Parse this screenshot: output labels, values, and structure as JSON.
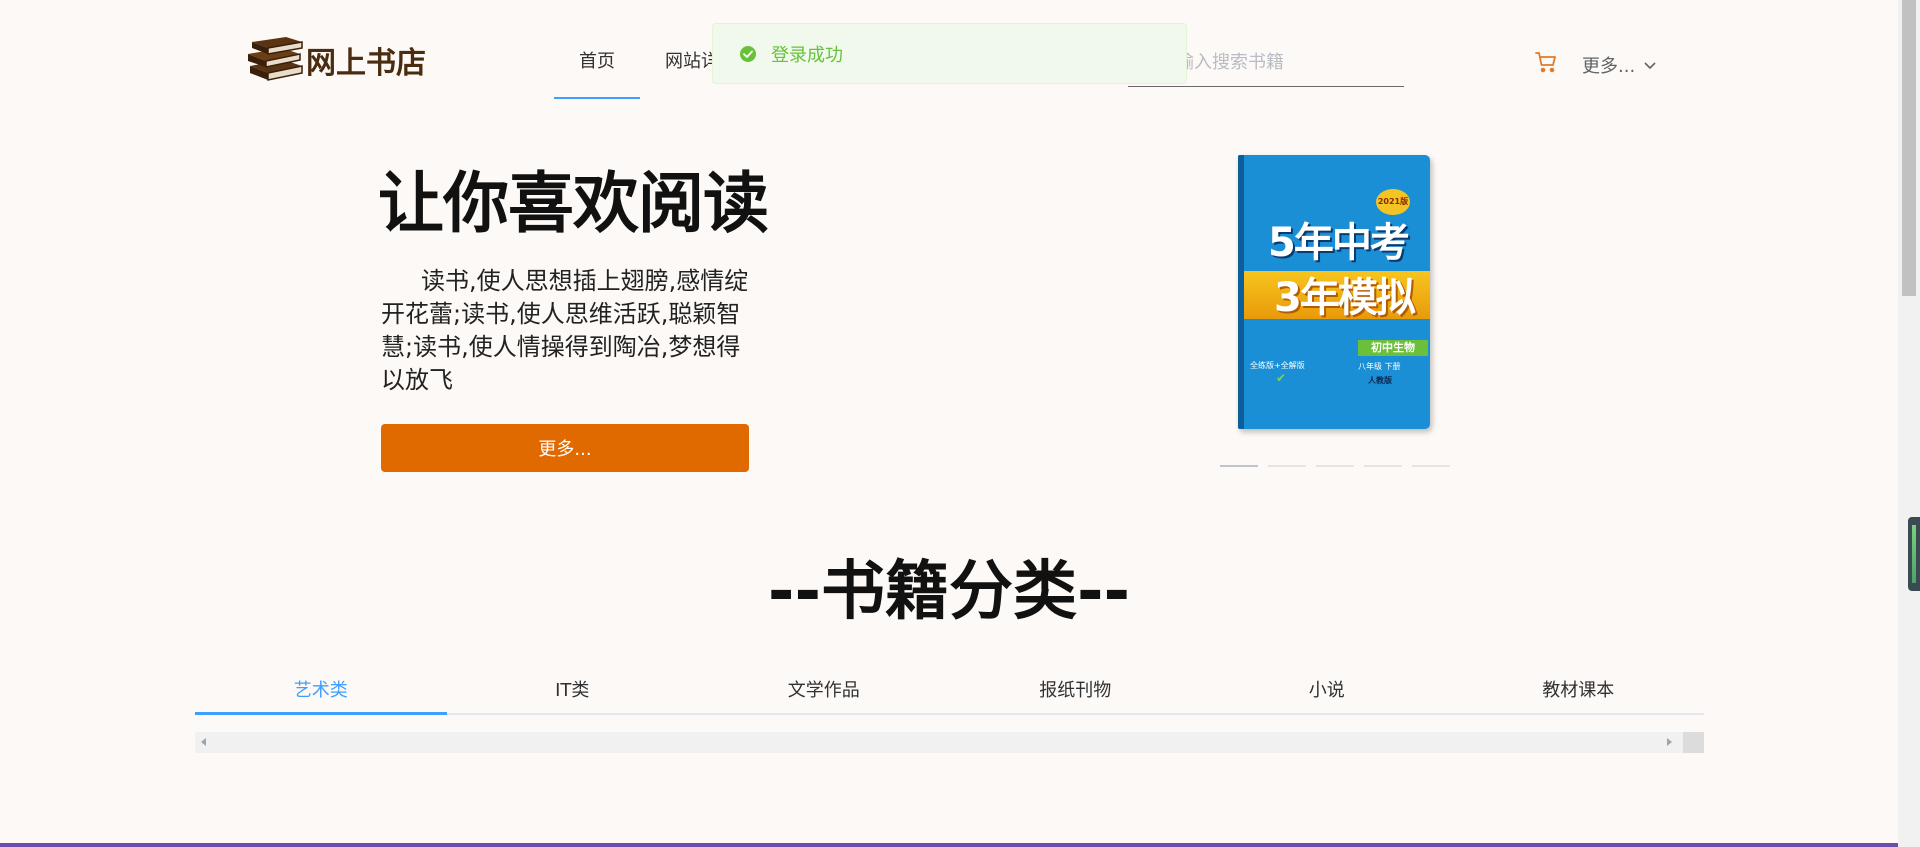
{
  "header": {
    "logo_text": "网上书店",
    "nav": [
      {
        "label": "首页",
        "active": true
      },
      {
        "label": "网站详"
      }
    ],
    "search_placeholder": "输入搜索书籍",
    "more_label": "更多..."
  },
  "toast": {
    "message": "登录成功",
    "type": "success"
  },
  "hero": {
    "title": "让你喜欢阅读",
    "text": "读书,使人思想插上翅膀,感情绽开花蕾;读书,使人思维活跃,聪颖智慧;读书,使人情操得到陶冶,梦想得以放飞",
    "button_label": "更多..."
  },
  "carousel": {
    "book": {
      "title_line1": "5年中考",
      "title_line2": "3年模拟",
      "badge": "2021版",
      "subject": "初中生物",
      "grade": "八年级 下册",
      "edition": "人教版",
      "tagline": "全练版+全解版"
    },
    "indicator_count": 5,
    "active_index": 0
  },
  "categories": {
    "title": "--书籍分类--",
    "tabs": [
      "艺术类",
      "IT类",
      "文学作品",
      "报纸刊物",
      "小说",
      "教材课本"
    ],
    "active_tab": 0
  },
  "colors": {
    "accent": "#409eff",
    "button": "#e06a00",
    "toast_bg": "#f0f9eb",
    "toast_text": "#67c23a",
    "logo": "#4a2c10"
  }
}
